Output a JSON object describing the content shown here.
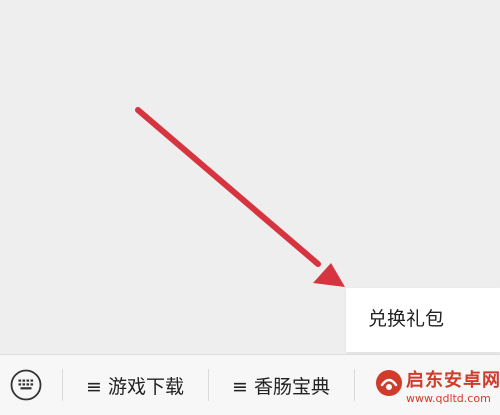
{
  "popup_menu": {
    "items": [
      {
        "label": "兑换礼包"
      }
    ]
  },
  "bottom_bar": {
    "menus": [
      {
        "label": "≡ 游戏下载"
      },
      {
        "label": "≡ 香肠宝典"
      }
    ]
  },
  "watermark": {
    "title": "启东安卓网",
    "url": "www.qdltd.com"
  },
  "colors": {
    "arrow": "#d6343f",
    "chat_background": "#efeeef",
    "bottom_bar_background": "#f7f7f7",
    "watermark": "#d13b2b"
  },
  "icons": {
    "keyboard": "keyboard-icon",
    "arrow": "red-arrow-annotation",
    "watermark_logo": "watermark-logo-icon"
  }
}
